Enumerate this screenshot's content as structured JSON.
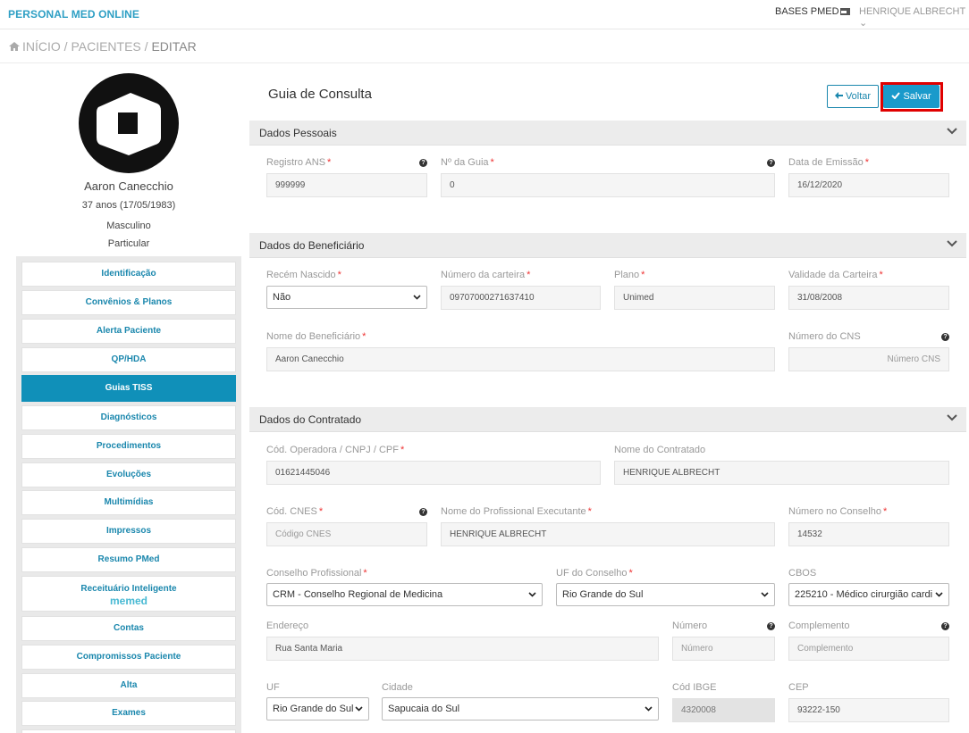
{
  "topbar": {
    "brand": "PERSONAL MED ONLINE",
    "bases": "BASES PMED",
    "user": "HENRIQUE ALBRECHT ⌄"
  },
  "breadcrumb": {
    "home": "INÍCIO",
    "sep1": "/",
    "pacientes": "PACIENTES",
    "sep2": "/",
    "editar": "EDITAR"
  },
  "patient": {
    "name": "Aaron Canecchio",
    "age": "37 anos (17/05/1983)",
    "sex": "Masculino",
    "type": "Particular"
  },
  "nav": [
    {
      "label": "Identificação"
    },
    {
      "label": "Convênios & Planos"
    },
    {
      "label": "Alerta Paciente"
    },
    {
      "label": "QP/HDA"
    },
    {
      "label": "Guias TISS"
    },
    {
      "label": "Diagnósticos"
    },
    {
      "label": "Procedimentos"
    },
    {
      "label": "Evoluções"
    },
    {
      "label": "Multimídias"
    },
    {
      "label": "Impressos"
    },
    {
      "label": "Resumo PMed"
    },
    {
      "label": "Receituário Inteligente",
      "sub": "memed"
    },
    {
      "label": "Contas"
    },
    {
      "label": "Compromissos Paciente"
    },
    {
      "label": "Alta"
    },
    {
      "label": "Exames"
    }
  ],
  "page": {
    "title": "Guia de Consulta",
    "voltar": "Voltar",
    "salvar": "Salvar"
  },
  "sections": {
    "pessoais": "Dados Pessoais",
    "beneficiario": "Dados do Beneficiário",
    "contratado": "Dados do Contratado"
  },
  "fields": {
    "registro_ans": {
      "label": "Registro ANS",
      "value": "999999"
    },
    "num_guia": {
      "label": "Nº da Guia",
      "value": "0"
    },
    "data_emissao": {
      "label": "Data de Emissão",
      "value": "16/12/2020"
    },
    "recem_nascido": {
      "label": "Recém Nascido",
      "value": "Não"
    },
    "num_carteira": {
      "label": "Número da carteira",
      "value": "09707000271637410"
    },
    "plano": {
      "label": "Plano",
      "value": "Unimed"
    },
    "validade": {
      "label": "Validade da Carteira",
      "value": "31/08/2008"
    },
    "nome_benef": {
      "label": "Nome do Beneficiário",
      "value": "Aaron Canecchio"
    },
    "num_cns": {
      "label": "Número do CNS",
      "placeholder": "Número CNS"
    },
    "cod_operadora": {
      "label": "Cód. Operadora / CNPJ / CPF",
      "value": "01621445046"
    },
    "nome_contratado": {
      "label": "Nome do Contratado",
      "value": "HENRIQUE ALBRECHT"
    },
    "cod_cnes": {
      "label": "Cód. CNES",
      "placeholder": "Código CNES"
    },
    "nome_prof": {
      "label": "Nome do Profissional Executante",
      "value": "HENRIQUE ALBRECHT"
    },
    "num_conselho": {
      "label": "Número no Conselho",
      "value": "14532"
    },
    "conselho": {
      "label": "Conselho Profissional",
      "value": "CRM - Conselho Regional de Medicina"
    },
    "uf_conselho": {
      "label": "UF do Conselho",
      "value": "Rio Grande do Sul"
    },
    "cbos": {
      "label": "CBOS",
      "value": "225210 - Médico cirurgião cardi"
    },
    "endereco": {
      "label": "Endereço",
      "value": "Rua Santa Maria"
    },
    "numero": {
      "label": "Número",
      "placeholder": "Número"
    },
    "complemento": {
      "label": "Complemento",
      "placeholder": "Complemento"
    },
    "uf": {
      "label": "UF",
      "value": "Rio Grande do Sul"
    },
    "cidade": {
      "label": "Cidade",
      "value": "Sapucaia do Sul"
    },
    "cod_ibge": {
      "label": "Cód IBGE",
      "value": "4320008"
    },
    "cep": {
      "label": "CEP",
      "value": "93222-150"
    }
  },
  "required_mark": "*",
  "help_glyph": "?",
  "colors": {
    "accent": "#1a9acb",
    "highlight": "#e00000",
    "brand": "#2e9fc4"
  }
}
